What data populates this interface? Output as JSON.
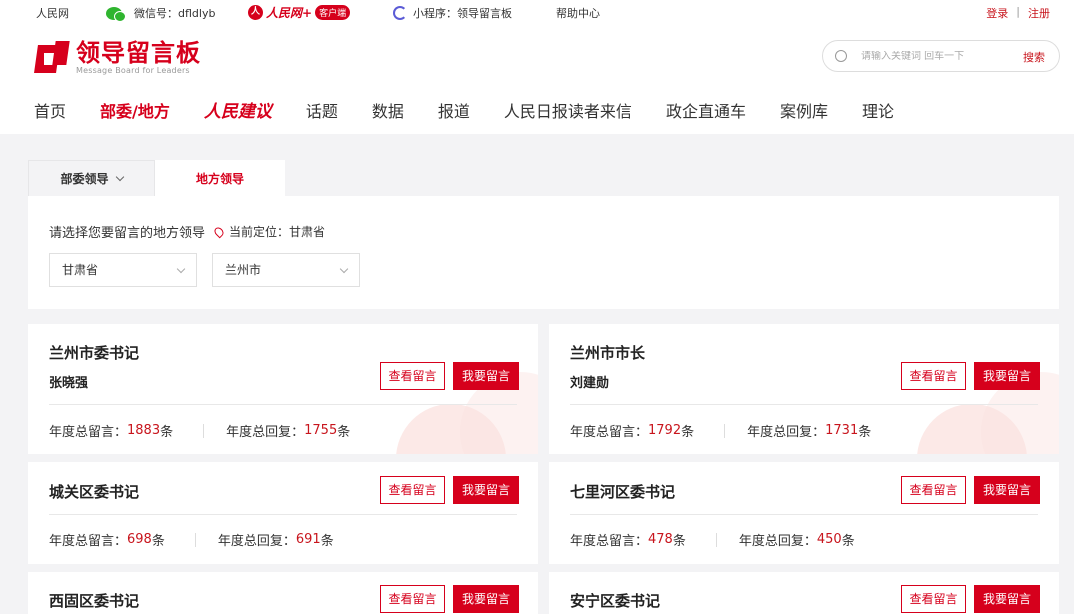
{
  "topbar": {
    "people": "人民网",
    "wechat": "微信号：dfldlyb",
    "rmw_circle": "人",
    "rmw_text": "人民网+",
    "rmw_tag": "客户端",
    "miniprogram": "小程序：领导留言板",
    "help": "帮助中心",
    "login": "登录",
    "separator": "|",
    "register": "注册"
  },
  "header": {
    "title": "领导留言板",
    "subtitle": "Message Board for Leaders",
    "search_placeholder": "请输入关键词 回车一下",
    "search_button": "搜索"
  },
  "nav": [
    "首页",
    "部委/地方",
    "人民建议",
    "话题",
    "数据",
    "报道",
    "人民日报读者来信",
    "政企直通车",
    "案例库",
    "理论"
  ],
  "tabs": {
    "ministry": "部委领导",
    "local": "地方领导"
  },
  "filter": {
    "prompt": "请选择您要留言的地方领导",
    "location": "当前定位：甘肃省",
    "province": "甘肃省",
    "city": "兰州市"
  },
  "buttons": {
    "view": "查看留言",
    "leave": "我要留言"
  },
  "stats_labels": {
    "total": "年度总留言：",
    "reply": "年度总回复：",
    "unit": "条"
  },
  "cards": [
    {
      "title": "兰州市委书记",
      "name": "张晓强",
      "total": "1883",
      "reply": "1755"
    },
    {
      "title": "兰州市市长",
      "name": "刘建勋",
      "total": "1792",
      "reply": "1731"
    },
    {
      "title": "城关区委书记",
      "total": "698",
      "reply": "691"
    },
    {
      "title": "七里河区委书记",
      "total": "478",
      "reply": "450"
    },
    {
      "title": "西固区委书记"
    },
    {
      "title": "安宁区委书记"
    }
  ],
  "colors": {
    "brand_red": "#d6001c",
    "bg": "#f3f3f5"
  }
}
